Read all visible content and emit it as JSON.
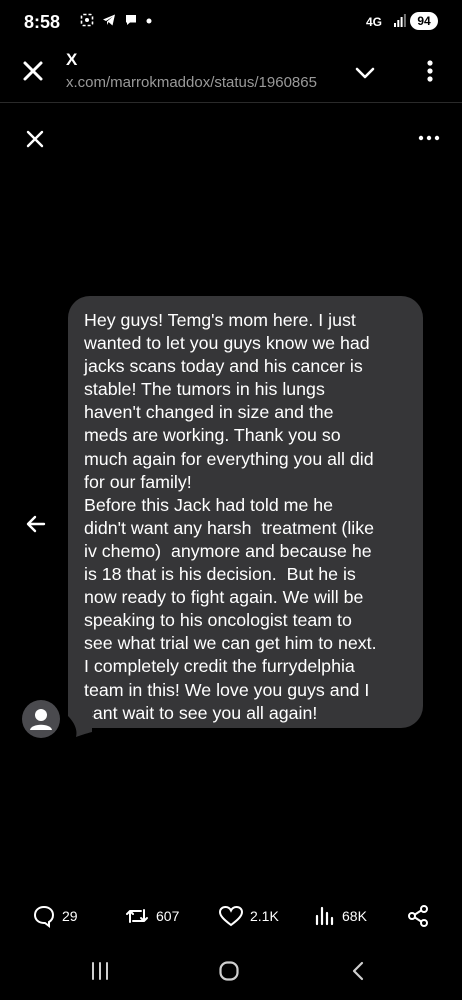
{
  "status_bar": {
    "time": "8:58",
    "notification_icons": [
      "screenshot-icon",
      "telegram-icon",
      "chat-icon",
      "dot-icon"
    ],
    "network": "4G",
    "battery": "94"
  },
  "browser": {
    "title": "X",
    "url": "x.com/marrokmaddox/status/1960865"
  },
  "media_viewer": {
    "message": "Hey guys! Temg's mom here. I just\nwanted to let you guys know we had\njacks scans today and his cancer is\nstable! The tumors in his lungs\nhaven't changed in size and the\nmeds are working. Thank you so\nmuch again for everything you all did\nfor our family!\nBefore this Jack had told me he\ndidn't want any harsh  treatment (like\niv chemo)  anymore and because he\nis 18 that is his decision.  But he is\nnow ready to fight again. We will be\nspeaking to his oncologist team to\nsee what trial we can get him to next.\nI completely credit the furrydelphia\nteam in this! We love you guys and I\ncant wait to see you all again!"
  },
  "actions": {
    "replies": "29",
    "reposts": "607",
    "likes": "2.1K",
    "views": "68K"
  },
  "colors": {
    "background": "#000000",
    "bubble": "#363638",
    "url_text": "#9a9a9a"
  }
}
